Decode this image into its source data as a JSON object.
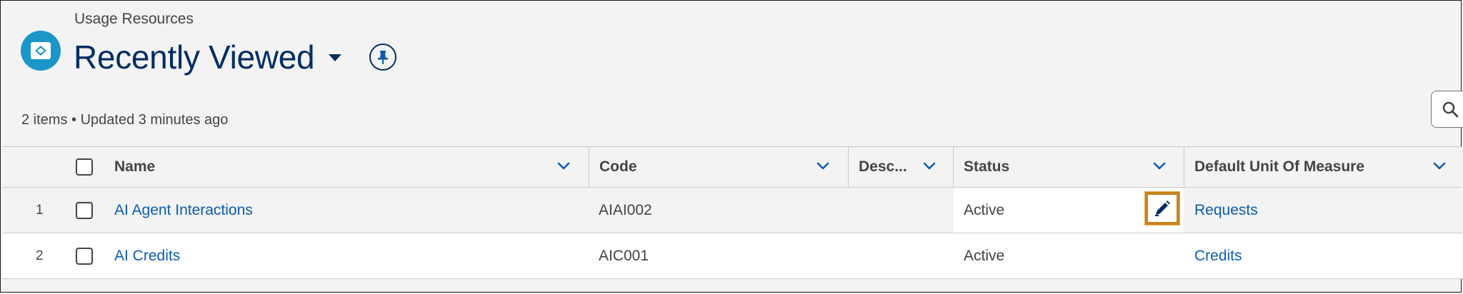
{
  "header": {
    "object_label": "Usage Resources",
    "list_title": "Recently Viewed",
    "status": "2 items • Updated 3 minutes ago"
  },
  "icons": {
    "app": "usage-resource-icon",
    "caret": "caret-down-icon",
    "pin": "pin-icon",
    "search": "search-icon",
    "sort": "chevron-down-icon",
    "edit": "pencil-icon"
  },
  "table": {
    "columns": [
      "Name",
      "Code",
      "Desc...",
      "Status",
      "Default Unit Of Measure"
    ],
    "rows": [
      {
        "num": "1",
        "name": "AI Agent Interactions",
        "code": "AIAI002",
        "description": "",
        "status": "Active",
        "unit": "Requests"
      },
      {
        "num": "2",
        "name": "AI Credits",
        "code": "AIC001",
        "description": "",
        "status": "Active",
        "unit": "Credits"
      }
    ]
  },
  "colors": {
    "title": "#032d60",
    "link": "#0b5cab",
    "app_icon": "#1b96c9",
    "highlight": "#c8831e"
  }
}
